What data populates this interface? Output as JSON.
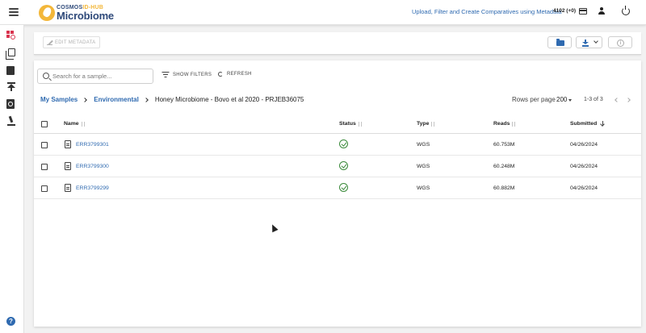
{
  "header": {
    "logo_top": "COSMOS",
    "logo_top_accent": "ID-HUB",
    "logo_bottom": "Microbiome",
    "upload_link": "Upload, Filter and Create Comparatives using Metadata",
    "credits": "4102 (+0)"
  },
  "toolbar": {
    "edit_metadata": "EDIT METADATA"
  },
  "search": {
    "placeholder": "Search for a sample..."
  },
  "actions": {
    "show_filters": "SHOW FILTERS",
    "refresh": "REFRESH"
  },
  "breadcrumb": {
    "items": [
      "My Samples",
      "Environmental"
    ],
    "current": "Honey Microbiome - Bovo et al 2020 - PRJEB36075"
  },
  "pagination": {
    "rows_per_page_label": "Rows per page",
    "rows_per_page": "200",
    "range": "1-3 of 3"
  },
  "table": {
    "columns": [
      "Name",
      "Status",
      "Type",
      "Reads",
      "Submitted"
    ],
    "rows": [
      {
        "name": "ERR3799301",
        "status": "complete",
        "type": "WGS",
        "reads": "60.753M",
        "submitted": "04/26/2024"
      },
      {
        "name": "ERR3799300",
        "status": "complete",
        "type": "WGS",
        "reads": "60.248M",
        "submitted": "04/26/2024"
      },
      {
        "name": "ERR3799299",
        "status": "complete",
        "type": "WGS",
        "reads": "60.882M",
        "submitted": "04/26/2024"
      }
    ]
  },
  "colors": {
    "accent": "#2f6ab0",
    "active_nav": "#d9344f",
    "status_ok": "#3a8a3a",
    "logo_gold": "#f3b73a"
  },
  "icons": {
    "nav": [
      "search-samples-icon",
      "copy-icon",
      "book-icon",
      "upload-icon",
      "document-search-icon",
      "microscope-icon",
      "help-icon"
    ]
  }
}
